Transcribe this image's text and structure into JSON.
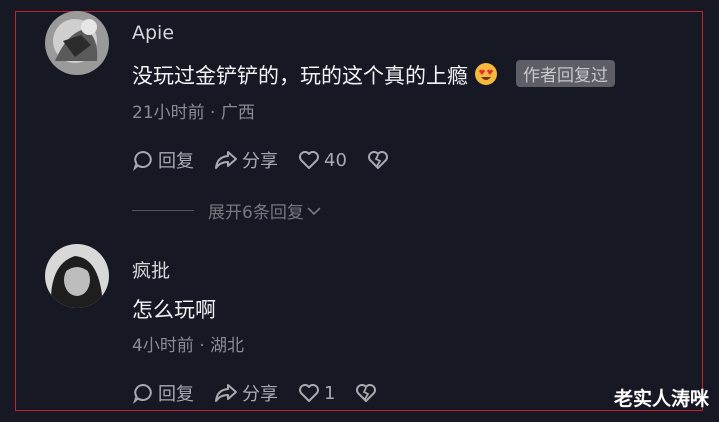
{
  "comments": [
    {
      "username": "Apie",
      "content": "没玩过金铲铲的，玩的这个真的上瘾",
      "emoji": "heart-eyes-emoji",
      "badge": "作者回复过",
      "time": "21小时前",
      "location": "广西",
      "reply_label": "回复",
      "share_label": "分享",
      "like_count": "40"
    },
    {
      "username": "疯批",
      "content": "怎么玩啊",
      "time": "4小时前",
      "location": "湖北",
      "reply_label": "回复",
      "share_label": "分享",
      "like_count": "1"
    }
  ],
  "expand_replies": "展开6条回复",
  "meta_separator": "·",
  "watermark": "老实人涛咪",
  "colors": {
    "background": "#161823",
    "frame_border": "#c4202e"
  }
}
